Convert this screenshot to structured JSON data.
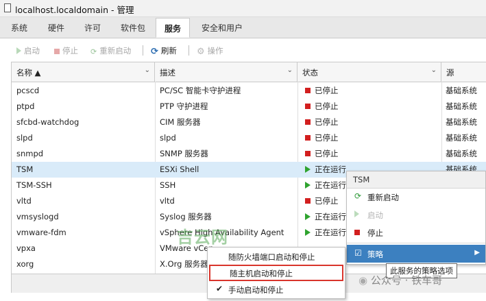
{
  "window": {
    "title": "localhost.localdomain - 管理"
  },
  "tabs": [
    {
      "label": "系统"
    },
    {
      "label": "硬件"
    },
    {
      "label": "许可"
    },
    {
      "label": "软件包"
    },
    {
      "label": "服务"
    },
    {
      "label": "安全和用户"
    }
  ],
  "active_tab": "服务",
  "toolbar": {
    "start": "启动",
    "stop": "停止",
    "restart": "重新启动",
    "refresh": "刷新",
    "actions": "操作"
  },
  "columns": {
    "name": "名称 ▲",
    "desc": "描述",
    "status": "状态",
    "source": "源"
  },
  "rows": [
    {
      "name": "pcscd",
      "desc": "PC/SC 智能卡守护进程",
      "status": "已停止",
      "source": "基础系统"
    },
    {
      "name": "ptpd",
      "desc": "PTP 守护进程",
      "status": "已停止",
      "source": "基础系统"
    },
    {
      "name": "sfcbd-watchdog",
      "desc": "CIM 服务器",
      "status": "已停止",
      "source": "基础系统"
    },
    {
      "name": "slpd",
      "desc": "slpd",
      "status": "已停止",
      "source": "基础系统"
    },
    {
      "name": "snmpd",
      "desc": "SNMP 服务器",
      "status": "已停止",
      "source": "基础系统"
    },
    {
      "name": "TSM",
      "desc": "ESXi Shell",
      "status": "正在运行",
      "source": "基础系统"
    },
    {
      "name": "TSM-SSH",
      "desc": "SSH",
      "status": "正在运行",
      "source": ""
    },
    {
      "name": "vltd",
      "desc": "vltd",
      "status": "已停止",
      "source": ""
    },
    {
      "name": "vmsyslogd",
      "desc": "Syslog 服务器",
      "status": "正在运行",
      "source": ""
    },
    {
      "name": "vmware-fdm",
      "desc": "vSphere High Availability Agent",
      "status": "正在运行",
      "source": ""
    },
    {
      "name": "vpxa",
      "desc": "VMware vCen",
      "status": "",
      "source": ""
    },
    {
      "name": "xorg",
      "desc": "X.Org 服务器",
      "status": "",
      "source": ""
    }
  ],
  "context_menu": {
    "header": "TSM",
    "items": [
      {
        "label": "重新启动"
      },
      {
        "label": "启动"
      },
      {
        "label": "停止"
      },
      {
        "label": "策略"
      }
    ]
  },
  "policy_submenu": [
    {
      "label": "随防火墙端口启动和停止"
    },
    {
      "label": "随主机启动和停止"
    },
    {
      "label": "手动启动和停止",
      "check": "✔"
    }
  ],
  "tooltip": "此服务的策略选项",
  "watermarks": {
    "site": "吉云网",
    "wechat": "公众号 · 铁车哥"
  }
}
